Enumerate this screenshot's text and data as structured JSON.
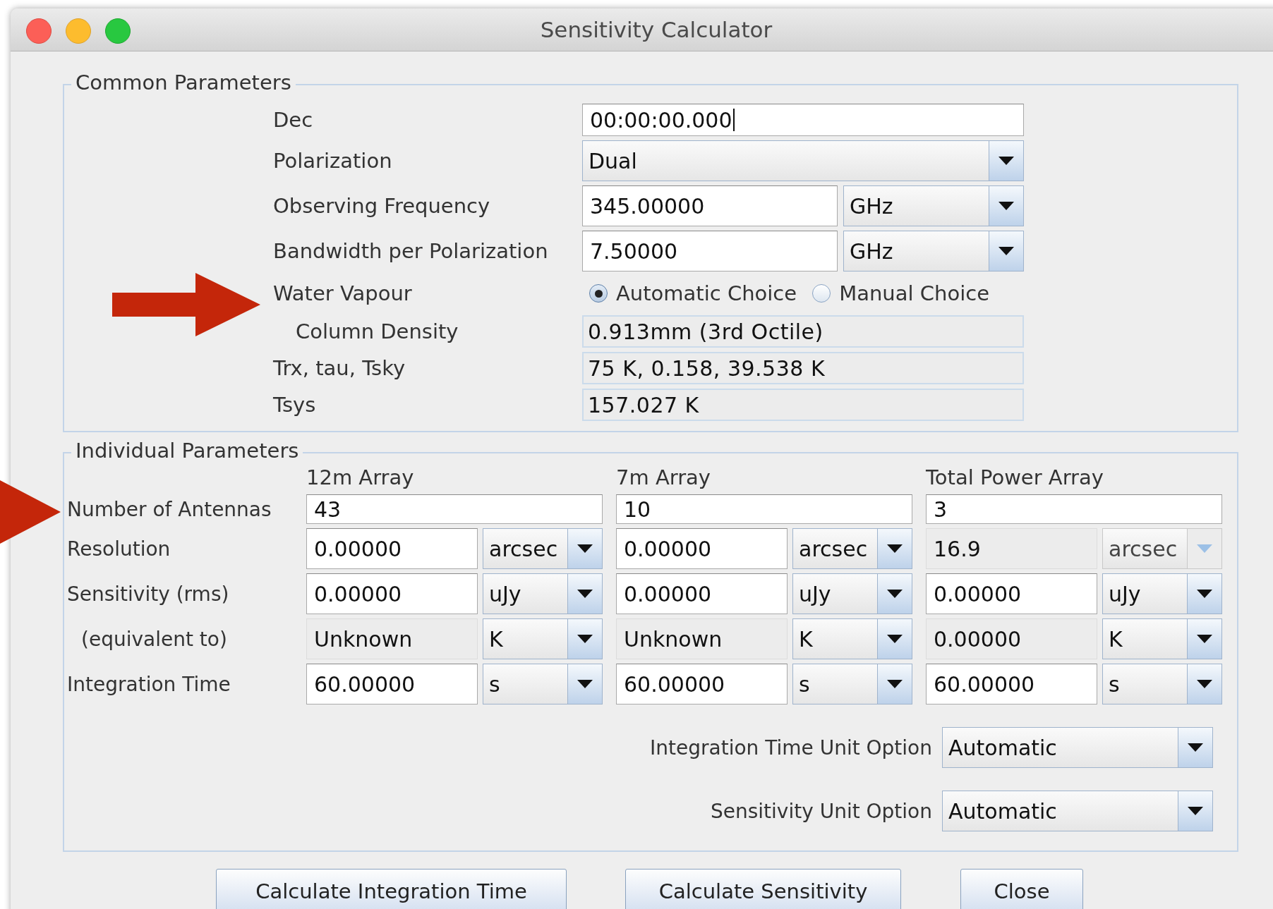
{
  "window": {
    "title": "Sensitivity Calculator"
  },
  "common": {
    "legend": "Common Parameters",
    "rows": [
      {
        "kind": "input",
        "label": "Dec",
        "value": "00:00:00.000",
        "focused": true
      },
      {
        "kind": "combo",
        "label": "Polarization",
        "value": "Dual"
      },
      {
        "kind": "input_unit",
        "label": "Observing Frequency",
        "value": "345.00000",
        "unit": "GHz"
      },
      {
        "kind": "input_unit",
        "label": "Bandwidth per Polarization",
        "value": "7.50000",
        "unit": "GHz"
      },
      {
        "kind": "radio",
        "label": "Water Vapour",
        "options": [
          {
            "label": "Automatic Choice",
            "selected": true
          },
          {
            "label": "Manual Choice",
            "selected": false
          }
        ]
      },
      {
        "kind": "readout",
        "label": "Column Density",
        "indent": true,
        "value": "0.913mm (3rd Octile)"
      },
      {
        "kind": "readout",
        "label": "Trx, tau, Tsky",
        "value": "75 K, 0.158, 39.538 K"
      },
      {
        "kind": "readout",
        "label": "Tsys",
        "value": "157.027 K"
      }
    ]
  },
  "individual": {
    "legend": "Individual Parameters",
    "columns": [
      "12m Array",
      "7m Array",
      "Total Power Array"
    ],
    "antennas": {
      "label": "Number of Antennas",
      "values": [
        "43",
        "10",
        "3"
      ]
    },
    "rows": [
      {
        "label": "Resolution",
        "indent": false,
        "cells": [
          {
            "value": "0.00000",
            "editable": true,
            "unit": "arcsec",
            "unit_enabled": true
          },
          {
            "value": "0.00000",
            "editable": true,
            "unit": "arcsec",
            "unit_enabled": true
          },
          {
            "value": "16.9",
            "editable": false,
            "unit": "arcsec",
            "unit_enabled": false
          }
        ]
      },
      {
        "label": "Sensitivity (rms)",
        "indent": false,
        "cells": [
          {
            "value": "0.00000",
            "editable": true,
            "unit": "uJy",
            "unit_enabled": true
          },
          {
            "value": "0.00000",
            "editable": true,
            "unit": "uJy",
            "unit_enabled": true
          },
          {
            "value": "0.00000",
            "editable": true,
            "unit": "uJy",
            "unit_enabled": true
          }
        ]
      },
      {
        "label": "(equivalent to)",
        "indent": true,
        "cells": [
          {
            "value": "Unknown",
            "editable": false,
            "unit": "K",
            "unit_enabled": true
          },
          {
            "value": "Unknown",
            "editable": false,
            "unit": "K",
            "unit_enabled": true
          },
          {
            "value": "0.00000",
            "editable": false,
            "unit": "K",
            "unit_enabled": true
          }
        ]
      },
      {
        "label": "Integration Time",
        "indent": false,
        "cells": [
          {
            "value": "60.00000",
            "editable": true,
            "unit": "s",
            "unit_enabled": true
          },
          {
            "value": "60.00000",
            "editable": true,
            "unit": "s",
            "unit_enabled": true
          },
          {
            "value": "60.00000",
            "editable": true,
            "unit": "s",
            "unit_enabled": true
          }
        ]
      }
    ],
    "options": [
      {
        "label": "Integration Time Unit Option",
        "value": "Automatic"
      },
      {
        "label": "Sensitivity Unit Option",
        "value": "Automatic"
      }
    ]
  },
  "buttons": [
    "Calculate Integration Time",
    "Calculate Sensitivity",
    "Close"
  ]
}
